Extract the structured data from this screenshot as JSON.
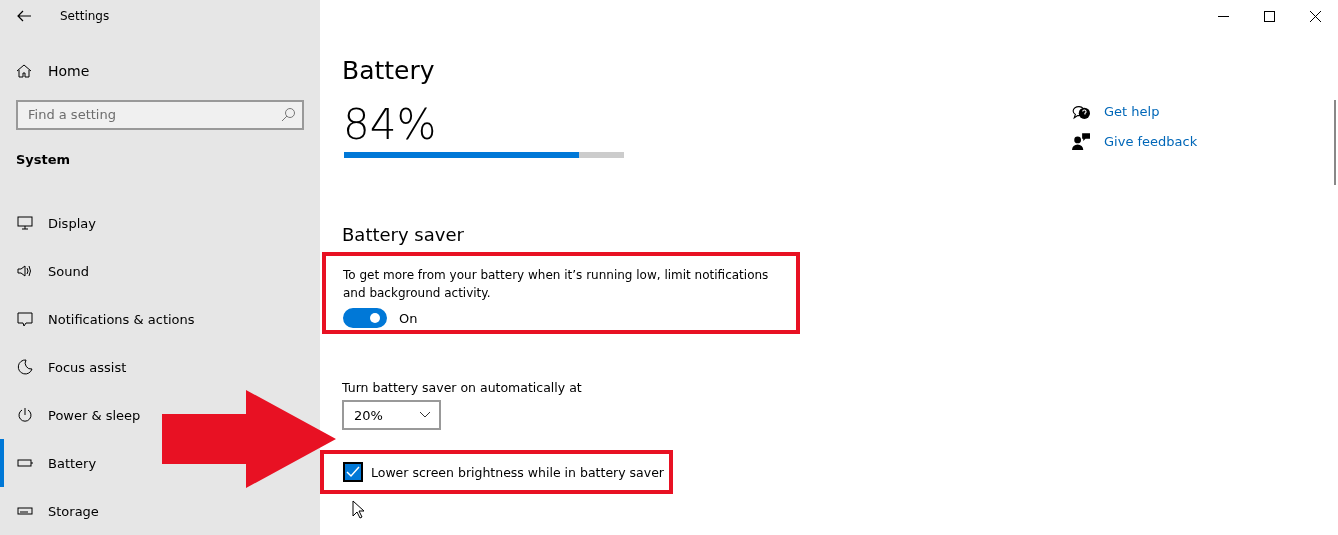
{
  "window": {
    "title": "Settings"
  },
  "sidebar": {
    "home": "Home",
    "search": {
      "placeholder": "Find a setting"
    },
    "section": "System",
    "items": [
      {
        "label": "Display",
        "selected": false
      },
      {
        "label": "Sound",
        "selected": false
      },
      {
        "label": "Notifications & actions",
        "selected": false
      },
      {
        "label": "Focus assist",
        "selected": false
      },
      {
        "label": "Power & sleep",
        "selected": false
      },
      {
        "label": "Battery",
        "selected": true
      },
      {
        "label": "Storage",
        "selected": false
      }
    ]
  },
  "main": {
    "title": "Battery",
    "percent": "84%",
    "level": 0.84,
    "saver": {
      "heading": "Battery saver",
      "description": "To get more from your battery when it’s running low, limit notifications and background activity.",
      "toggle": {
        "on": true,
        "label": "On"
      },
      "auto_label": "Turn battery saver on automatically at",
      "auto_value": "20%",
      "checkbox": {
        "label": "Lower screen brightness while in battery saver",
        "checked": true
      }
    }
  },
  "links": [
    {
      "label": "Get help"
    },
    {
      "label": "Give feedback"
    }
  ]
}
